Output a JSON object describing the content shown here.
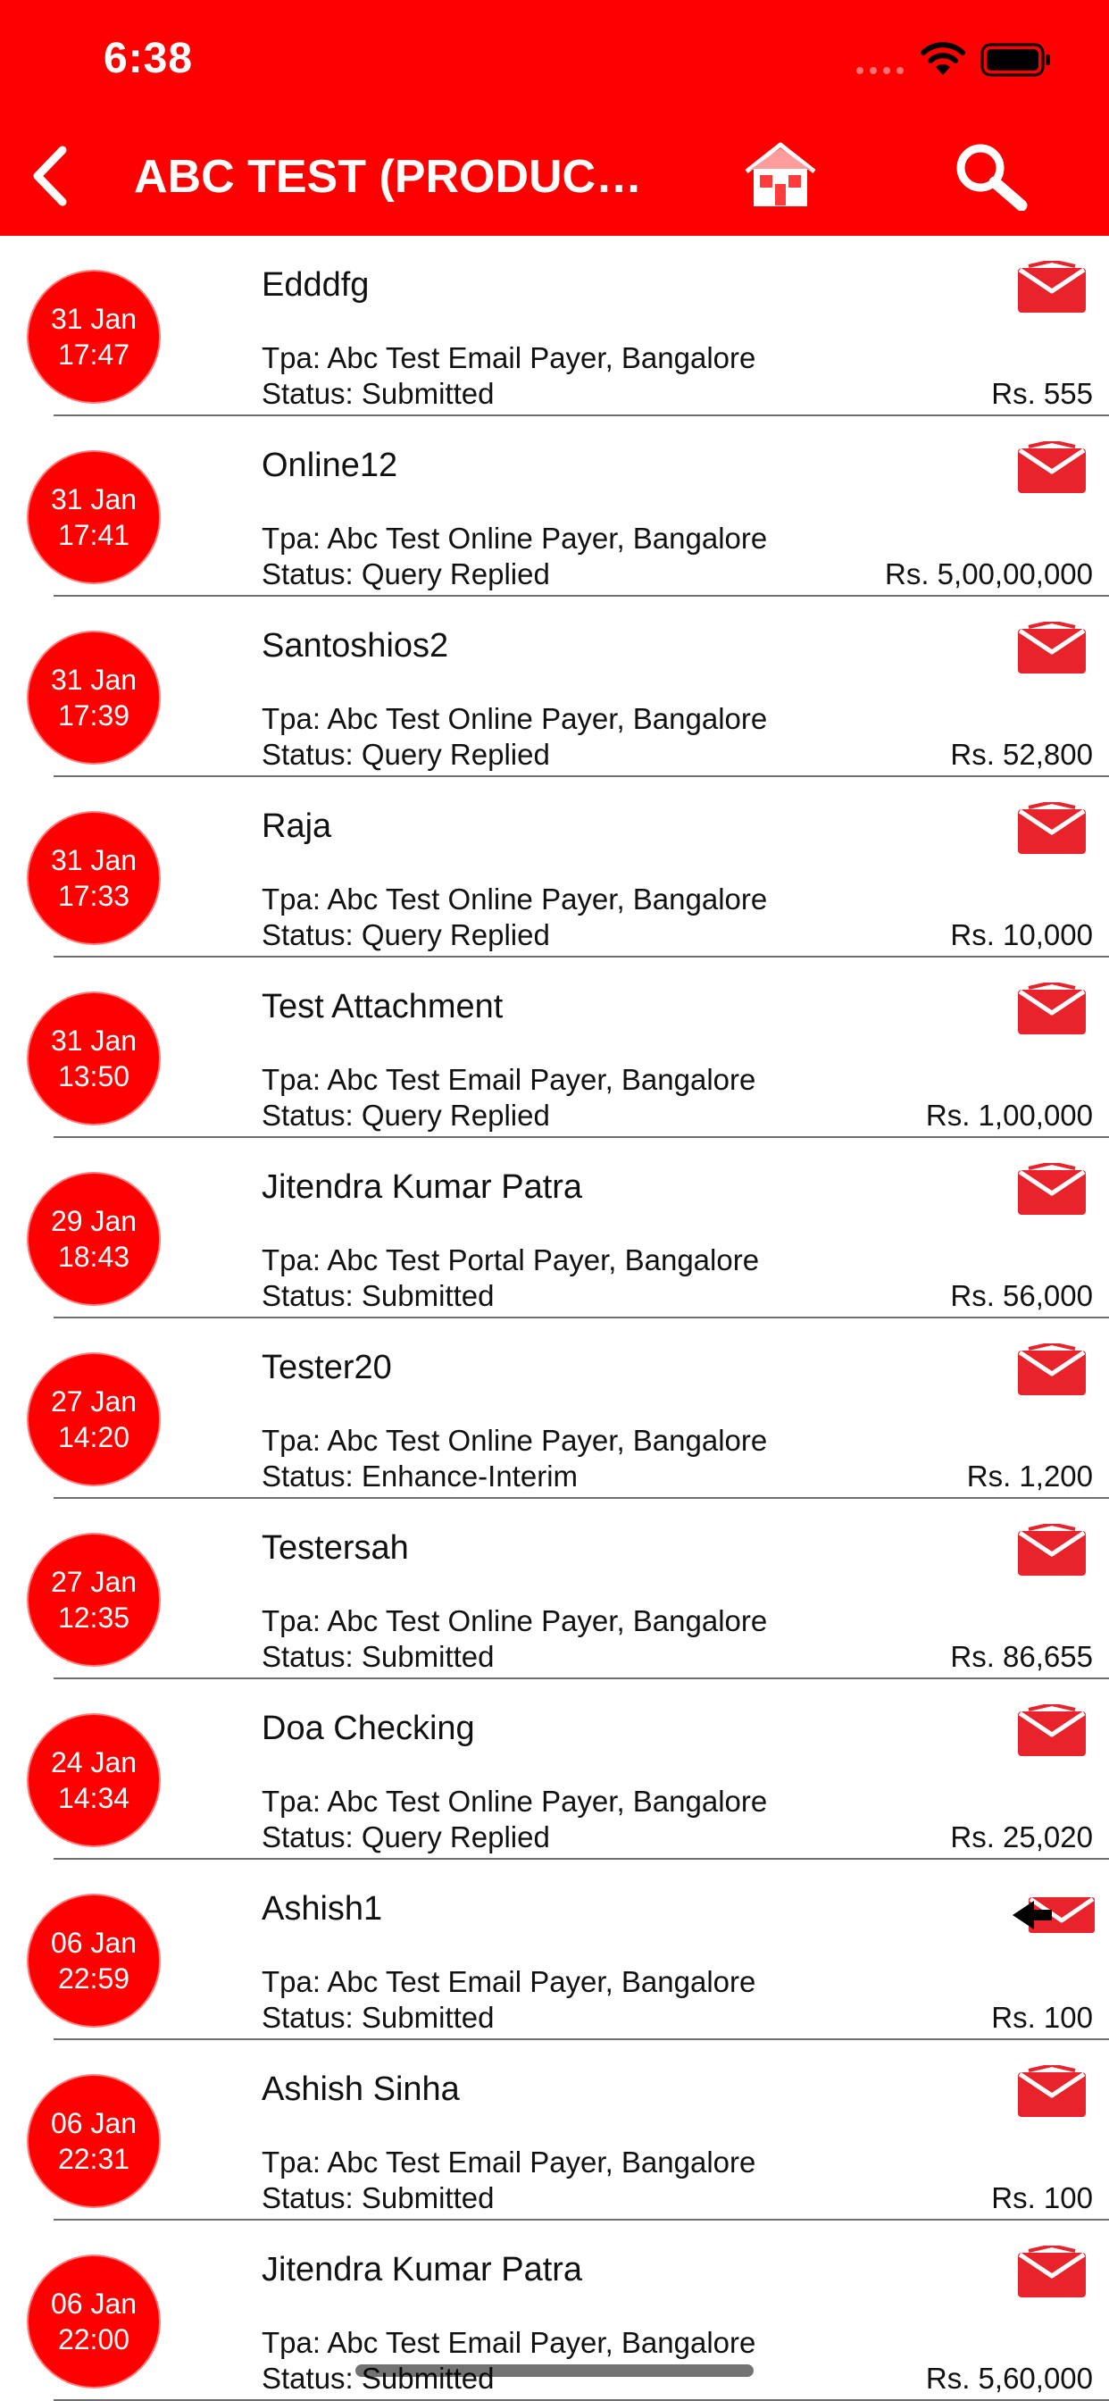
{
  "status_bar": {
    "time": "6:38"
  },
  "header": {
    "title": "ABC TEST (PRODUCTI...",
    "background": "#ff0000",
    "back_icon": "chevron-left-icon",
    "home_icon": "house-icon",
    "search_icon": "magnifier-icon"
  },
  "colors": {
    "accent": "#ff0000",
    "mail_icon": "#e8232b"
  },
  "items": [
    {
      "day": "31 Jan",
      "time": "17:47",
      "title": "Edddfg",
      "tpa": "Tpa: Abc Test Email Payer, Bangalore",
      "status": "Status: Submitted",
      "amount": "Rs. 555",
      "icon": "envelope-icon"
    },
    {
      "day": "31 Jan",
      "time": "17:41",
      "title": "Online12",
      "tpa": "Tpa: Abc Test Online Payer, Bangalore",
      "status": "Status: Query Replied",
      "amount": "Rs. 5,00,00,000",
      "icon": "envelope-icon"
    },
    {
      "day": "31 Jan",
      "time": "17:39",
      "title": "Santoshios2",
      "tpa": "Tpa: Abc Test Online Payer, Bangalore",
      "status": "Status: Query Replied",
      "amount": "Rs. 52,800",
      "icon": "envelope-icon"
    },
    {
      "day": "31 Jan",
      "time": "17:33",
      "title": "Raja",
      "tpa": "Tpa: Abc Test Online Payer, Bangalore",
      "status": "Status: Query Replied",
      "amount": "Rs. 10,000",
      "icon": "envelope-icon"
    },
    {
      "day": "31 Jan",
      "time": "13:50",
      "title": "Test Attachment",
      "tpa": "Tpa: Abc Test Email Payer, Bangalore",
      "status": "Status: Query Replied",
      "amount": "Rs. 1,00,000",
      "icon": "envelope-icon"
    },
    {
      "day": "29 Jan",
      "time": "18:43",
      "title": "Jitendra Kumar Patra",
      "tpa": "Tpa: Abc Test Portal Payer, Bangalore",
      "status": "Status: Submitted",
      "amount": "Rs. 56,000",
      "icon": "envelope-icon"
    },
    {
      "day": "27 Jan",
      "time": "14:20",
      "title": "Tester20",
      "tpa": "Tpa: Abc Test Online Payer, Bangalore",
      "status": "Status: Enhance-Interim",
      "amount": "Rs. 1,200",
      "icon": "envelope-icon"
    },
    {
      "day": "27 Jan",
      "time": "12:35",
      "title": "Testersah",
      "tpa": "Tpa: Abc Test Online Payer, Bangalore",
      "status": "Status: Submitted",
      "amount": "Rs. 86,655",
      "icon": "envelope-icon"
    },
    {
      "day": "24 Jan",
      "time": "14:34",
      "title": "Doa Checking",
      "tpa": "Tpa: Abc Test Online Payer, Bangalore",
      "status": "Status: Query Replied",
      "amount": "Rs. 25,020",
      "icon": "envelope-icon"
    },
    {
      "day": "06 Jan",
      "time": "22:59",
      "title": "Ashish1",
      "tpa": "Tpa: Abc Test Email Payer, Bangalore",
      "status": "Status: Submitted",
      "amount": "Rs. 100",
      "icon": "envelope-reply-icon"
    },
    {
      "day": "06 Jan",
      "time": "22:31",
      "title": "Ashish Sinha",
      "tpa": "Tpa: Abc Test Email Payer, Bangalore",
      "status": "Status: Submitted",
      "amount": "Rs. 100",
      "icon": "envelope-icon"
    },
    {
      "day": "06 Jan",
      "time": "22:00",
      "title": "Jitendra Kumar Patra",
      "tpa": "Tpa: Abc Test Email Payer, Bangalore",
      "status": "Status: Submitted",
      "amount": "Rs. 5,60,000",
      "icon": "envelope-icon"
    }
  ]
}
